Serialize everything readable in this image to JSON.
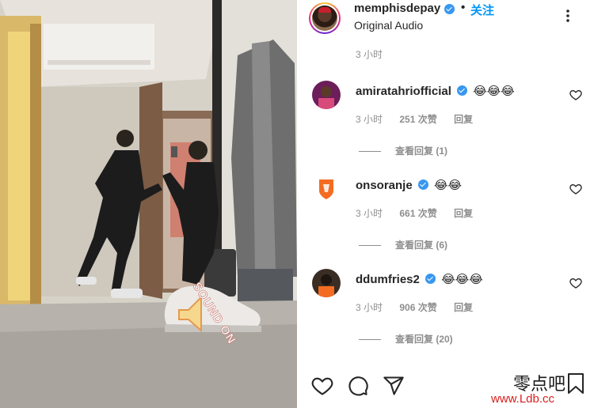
{
  "post": {
    "username": "memphisdepay",
    "follow_label": "关注",
    "audio": "Original Audio",
    "caption_time": "3 小时"
  },
  "comments": [
    {
      "username": "amiratahriofficial",
      "emojis": "😂😂😂",
      "time": "3 小时",
      "likes": "251 次赞",
      "reply_label": "回复",
      "view_replies": "查看回复 (1)"
    },
    {
      "username": "onsoranje",
      "emojis": "😂😂",
      "time": "3 小时",
      "likes": "661 次赞",
      "reply_label": "回复",
      "view_replies": "查看回复 (6)"
    },
    {
      "username": "ddumfries2",
      "emojis": "😂😂😂",
      "time": "3 小时",
      "likes": "906 次赞",
      "reply_label": "回复",
      "view_replies": "查看回复 (20)"
    }
  ],
  "media": {
    "sound_badge": "SOUND ON"
  },
  "actions": [
    "heart-icon",
    "comment-icon",
    "share-icon"
  ],
  "watermark": {
    "site_cn": "零点吧",
    "site_url": "www.Ldb.cc"
  },
  "colors": {
    "follow_blue": "#0095f6",
    "verified_blue": "#3897f0",
    "meta_gray": "#8e8e8e",
    "watermark_red": "#d81e1e",
    "orange_brand": "#f36c21"
  }
}
